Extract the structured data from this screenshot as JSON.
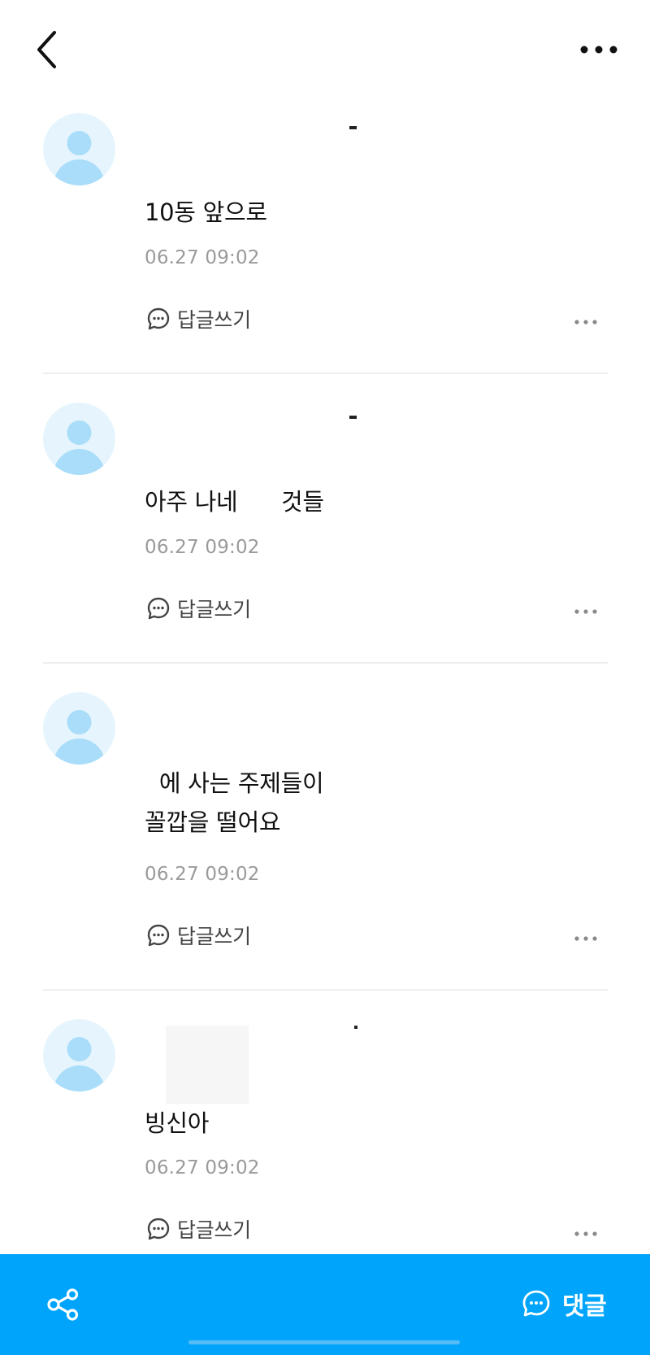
{
  "header": {
    "back_icon": "chevron-left-icon",
    "more_icon": "more-horizontal-icon"
  },
  "comments": [
    {
      "text": "10동 앞으로",
      "time": "06.27 09:02",
      "reply_label": "답글쓰기"
    },
    {
      "text": "아주 나네      것들",
      "time": "06.27 09:02",
      "reply_label": "답글쓰기"
    },
    {
      "text_line1": "  에 사는 주제들이",
      "text_line2": "꼴깝을 떨어요",
      "time": "06.27 09:02",
      "reply_label": "답글쓰기"
    },
    {
      "text": "빙신아",
      "time": "06.27 09:02",
      "reply_label": "답글쓰기"
    }
  ],
  "bottom_bar": {
    "share_icon": "share-icon",
    "comment_label": "댓글",
    "comment_icon": "chat-bubble-icon",
    "accent_color": "#00a5fb"
  }
}
